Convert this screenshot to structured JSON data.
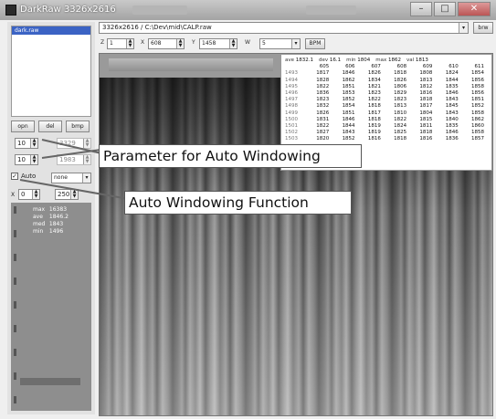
{
  "window": {
    "title": "DarkRaw 3326x2616",
    "controls": {
      "minimize": "–",
      "maximize": "□",
      "close": "✕"
    }
  },
  "file_list": {
    "selected_item": "dark.raw"
  },
  "left_buttons": {
    "open": "opn",
    "delete": "del",
    "bmp": "bmp"
  },
  "window_params": {
    "param1_value": "10",
    "param1_right_value": "3329",
    "param2_value": "10",
    "param2_right_value": "1983"
  },
  "auto_checkbox": {
    "label": "Auto",
    "checked": true
  },
  "mode_combo": {
    "value": "none"
  },
  "range": {
    "x_label": "X",
    "start": "0",
    "end": "250"
  },
  "stats": {
    "max_label": "max",
    "max_value": "16383",
    "ave_label": "ave",
    "ave_value": "1846.2",
    "med_label": "med",
    "med_value": "1843",
    "min_label": "min",
    "min_value": "1496"
  },
  "path": {
    "value": "3326x2616 / C:\\Dev\\mid\\CALP.raw",
    "browse_label": "brw"
  },
  "toolbar": {
    "z_label": "Z",
    "z_value": "1",
    "x_label": "X",
    "x_value": "608",
    "y_label": "Y",
    "y_value": "1458",
    "w_label": "W",
    "w_value": "5",
    "bpm_label": "BPM"
  },
  "pixel_table": {
    "summary": [
      {
        "label": "ave",
        "value": "1832.1"
      },
      {
        "label": "dev",
        "value": "16.1"
      },
      {
        "label": "min",
        "value": "1804"
      },
      {
        "label": "max",
        "value": "1862"
      },
      {
        "label": "val",
        "value": "1813"
      }
    ],
    "columns": [
      "605",
      "606",
      "607",
      "608",
      "609",
      "610",
      "611"
    ],
    "rows": [
      {
        "label": "1493",
        "cells": [
          "1817",
          "1846",
          "1826",
          "1818",
          "1808",
          "1824",
          "1854"
        ]
      },
      {
        "label": "1494",
        "cells": [
          "1828",
          "1862",
          "1834",
          "1826",
          "1813",
          "1844",
          "1856"
        ]
      },
      {
        "label": "1495",
        "cells": [
          "1822",
          "1851",
          "1821",
          "1806",
          "1812",
          "1835",
          "1858"
        ]
      },
      {
        "label": "1496",
        "cells": [
          "1836",
          "1853",
          "1823",
          "1829",
          "1816",
          "1846",
          "1856"
        ]
      },
      {
        "label": "1497",
        "cells": [
          "1823",
          "1852",
          "1822",
          "1823",
          "1818",
          "1843",
          "1851"
        ]
      },
      {
        "label": "1498",
        "cells": [
          "1832",
          "1854",
          "1818",
          "1813",
          "1817",
          "1845",
          "1852"
        ]
      },
      {
        "label": "1499",
        "cells": [
          "1826",
          "1851",
          "1817",
          "1810",
          "1804",
          "1843",
          "1858"
        ]
      },
      {
        "label": "1500",
        "cells": [
          "1831",
          "1846",
          "1818",
          "1822",
          "1815",
          "1840",
          "1862"
        ]
      },
      {
        "label": "1501",
        "cells": [
          "1822",
          "1844",
          "1819",
          "1824",
          "1811",
          "1835",
          "1860"
        ]
      },
      {
        "label": "1502",
        "cells": [
          "1827",
          "1843",
          "1819",
          "1825",
          "1818",
          "1846",
          "1858"
        ]
      },
      {
        "label": "1503",
        "cells": [
          "1820",
          "1852",
          "1816",
          "1818",
          "1816",
          "1836",
          "1857"
        ]
      }
    ]
  },
  "annotations": {
    "parameter_callout": "Parameter for Auto Windowing",
    "function_callout": "Auto Windowing Function"
  }
}
